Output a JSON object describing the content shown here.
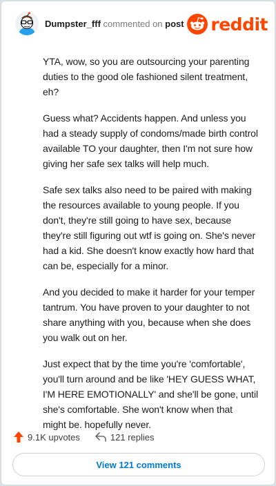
{
  "header": {
    "username": "Dumpster_fff",
    "action_text": "commented on",
    "target": "post",
    "logo_text": "reddit",
    "logo_icon": "snoo-icon"
  },
  "comment": {
    "paragraphs": [
      "YTA, wow, so you are outsourcing your parenting duties to the good ole fashioned silent treatment, eh?",
      "Guess what? Accidents happen. And unless you had a steady supply of condoms/made birth control available TO your daughter, then I'm not sure how giving her safe sex talks will help much.",
      "Safe sex talks also need to be paired with making the resources available to young people. If you don't, they're still going to have sex, because they're still figuring out wtf is going on. She's never had a kid. She doesn't know exactly how hard that can be, especially for a minor.",
      "And you decided to make it harder for your temper tantrum. You have proven to your daughter to not share anything with you, because when she does you walk out on her.",
      "Just expect that by the time you're 'comfortable', you'll turn around and be like 'HEY GUESS WHAT, I'M HERE EMOTIONALLY' and she'll be gone, until she's comfortable. She won't know when that might be. hopefully never."
    ]
  },
  "footer": {
    "upvotes": "9.1K upvotes",
    "replies": "121 replies",
    "view_comments": "View 121 comments"
  },
  "colors": {
    "brand": "#ff4500",
    "link": "#0079d3",
    "text": "#1c1c1c",
    "muted": "#7c7c7c"
  }
}
